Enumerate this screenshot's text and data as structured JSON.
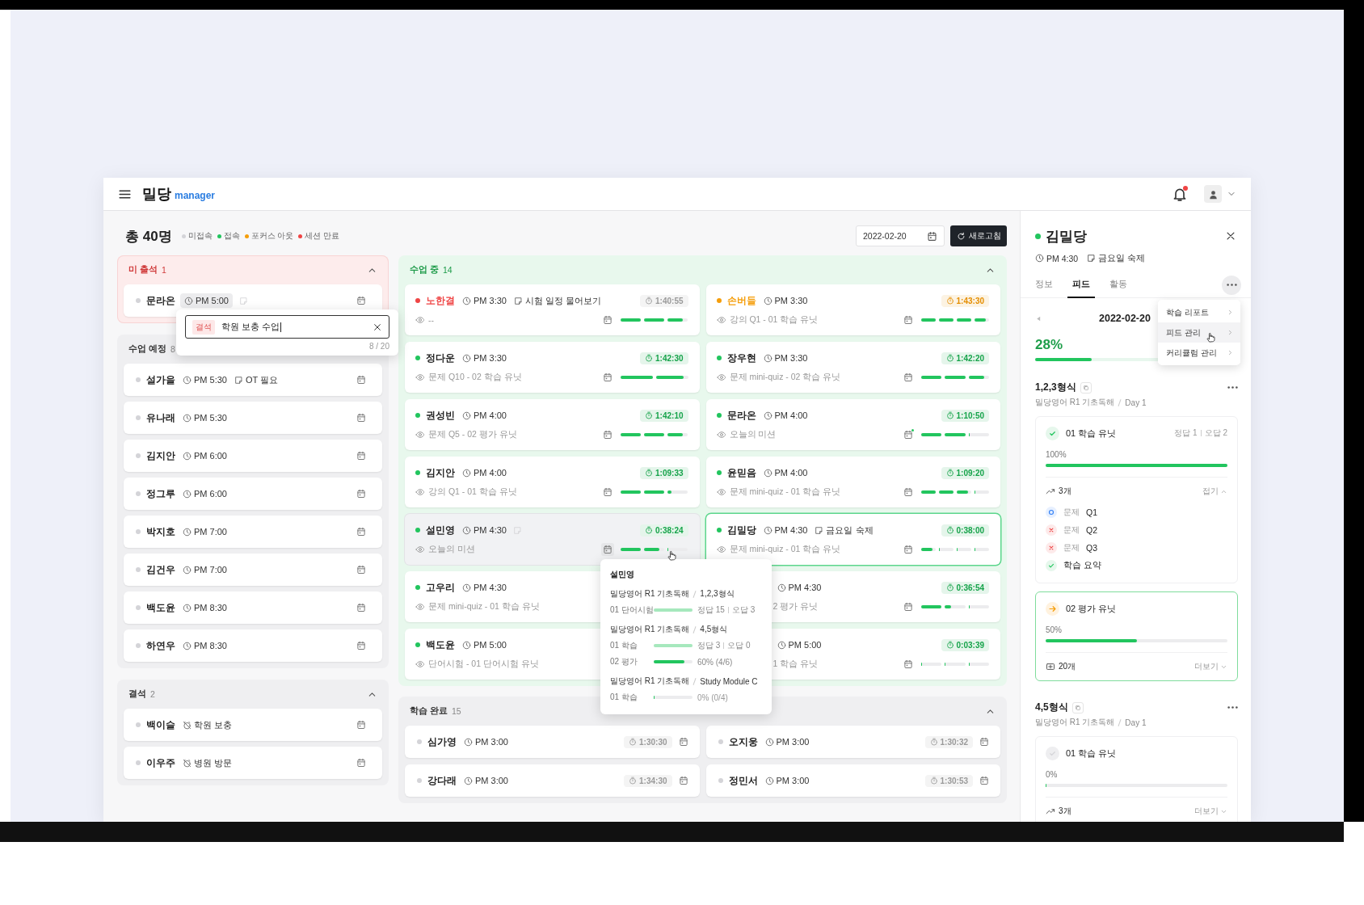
{
  "header": {
    "logo_main": "밀당",
    "logo_sub": "manager",
    "notification_dot": true
  },
  "summary": {
    "title": "총 40명",
    "legend": [
      {
        "label": "미접속",
        "color": "#d4d4d8"
      },
      {
        "label": "접속",
        "color": "#22c55e"
      },
      {
        "label": "포커스 아웃",
        "color": "#f59e0b"
      },
      {
        "label": "세션 만료",
        "color": "#ef4444"
      }
    ],
    "date": "2022-02-20",
    "refresh_label": "새로고침"
  },
  "left_panels": [
    {
      "kind": "absent",
      "title": "미 출석",
      "count": "1",
      "expanded": true,
      "students": [
        {
          "name": "문라온",
          "color": "#d4d4d8",
          "time": "PM 5:00",
          "has_memo": true,
          "editing": true
        }
      ]
    },
    {
      "kind": "scheduled",
      "title": "수업 예정",
      "count": "8",
      "students": [
        {
          "name": "설가을",
          "color": "#d4d4d8",
          "time": "PM 5:30",
          "note": "OT 필요"
        },
        {
          "name": "유나래",
          "color": "#d4d4d8",
          "time": "PM 5:30"
        },
        {
          "name": "김지안",
          "color": "#d4d4d8",
          "time": "PM 6:00"
        },
        {
          "name": "정그루",
          "color": "#d4d4d8",
          "time": "PM 6:00"
        },
        {
          "name": "박지호",
          "color": "#d4d4d8",
          "time": "PM 7:00"
        },
        {
          "name": "김건우",
          "color": "#d4d4d8",
          "time": "PM 7:00"
        },
        {
          "name": "백도윤",
          "color": "#d4d4d8",
          "time": "PM 8:30"
        },
        {
          "name": "하연우",
          "color": "#d4d4d8",
          "time": "PM 8:30"
        }
      ]
    },
    {
      "kind": "absence",
      "title": "결석",
      "count": "2",
      "expanded": true,
      "students": [
        {
          "name": "백이슬",
          "color": "#d4d4d8",
          "reason": "학원 보충"
        },
        {
          "name": "이우주",
          "color": "#d4d4d8",
          "reason": "병원 방문"
        }
      ]
    }
  ],
  "absence_popover": {
    "tag": "결석",
    "value": "학원 보충 수업",
    "counter": "8 / 20"
  },
  "board": [
    {
      "kind": "in_class",
      "title": "수업 중",
      "count": "14",
      "expanded": true,
      "cards": [
        {
          "name": "노한결",
          "color": "#ef4444",
          "name_highlight": true,
          "time": "PM 3:30",
          "note": "시험 일정 물어보기",
          "timer": {
            "text": "1:40:55",
            "color": "#9a9a9a"
          },
          "mission": "--",
          "segments": [
            {
              "level": 1
            },
            {
              "level": 1
            },
            {
              "level": 0.75
            }
          ],
          "calendar_dot": false,
          "hovered": false,
          "selected": false
        },
        {
          "name": "손버들",
          "color": "#f59e0b",
          "name_highlight": true,
          "time": "PM 3:30",
          "timer": {
            "text": "1:43:30",
            "color": "#e58e00"
          },
          "mission": "강의 Q1 - 01 학습 유닛",
          "segments": [
            {
              "level": 1
            },
            {
              "level": 1
            },
            {
              "level": 1
            },
            {
              "level": 0.75
            }
          ],
          "calendar_dot": false,
          "hovered": false,
          "selected": false
        },
        {
          "name": "정다운",
          "color": "#22c55e",
          "name_highlight": false,
          "time": "PM 3:30",
          "timer": {
            "text": "1:42:30",
            "color": "#16a34a"
          },
          "mission": "문제 Q10 - 02 학습 유닛",
          "segments": [
            {
              "level": 1
            },
            {
              "level": 0.87
            }
          ],
          "calendar_dot": false,
          "hovered": false,
          "selected": false
        },
        {
          "name": "장우현",
          "color": "#22c55e",
          "name_highlight": false,
          "time": "PM 3:30",
          "timer": {
            "text": "1:42:20",
            "color": "#16a34a"
          },
          "mission": "문제 mini-quiz - 02 학습 유닛",
          "segments": [
            {
              "level": 1
            },
            {
              "level": 1
            },
            {
              "level": 0.75
            }
          ],
          "calendar_dot": false,
          "hovered": false,
          "selected": false
        },
        {
          "name": "권성빈",
          "color": "#22c55e",
          "name_highlight": false,
          "time": "PM 4:00",
          "timer": {
            "text": "1:42:10",
            "color": "#16a34a"
          },
          "mission": "문제 Q5 - 02 평가 유닛",
          "segments": [
            {
              "level": 1
            },
            {
              "level": 1
            },
            {
              "level": 0.75
            }
          ],
          "calendar_dot": false,
          "hovered": false,
          "selected": false
        },
        {
          "name": "문라온",
          "color": "#22c55e",
          "name_highlight": false,
          "time": "PM 4:00",
          "timer": {
            "text": "1:10:50",
            "color": "#16a34a"
          },
          "mission": "오늘의 미션",
          "segments": [
            {
              "level": 1
            },
            {
              "level": 1
            },
            {
              "level": 0
            }
          ],
          "calendar_dot": true,
          "hovered": false,
          "selected": false
        },
        {
          "name": "김지안",
          "color": "#22c55e",
          "name_highlight": false,
          "time": "PM 4:00",
          "timer": {
            "text": "1:09:33",
            "color": "#16a34a"
          },
          "mission": "강의 Q1 - 01 학습 유닛",
          "segments": [
            {
              "level": 1
            },
            {
              "level": 1
            },
            {
              "level": 0.18
            }
          ],
          "calendar_dot": false,
          "hovered": false,
          "selected": false
        },
        {
          "name": "윤믿음",
          "color": "#22c55e",
          "name_highlight": false,
          "time": "PM 4:00",
          "timer": {
            "text": "1:09:20",
            "color": "#16a34a"
          },
          "mission": "문제 mini-quiz - 01 학습 유닛",
          "segments": [
            {
              "level": 1
            },
            {
              "level": 1
            },
            {
              "level": 0.75
            },
            {
              "level": 0
            }
          ],
          "calendar_dot": false,
          "hovered": false,
          "selected": false
        },
        {
          "name": "설민영",
          "color": "#22c55e",
          "name_highlight": false,
          "time": "PM 4:30",
          "has_memo": true,
          "timer": {
            "text": "0:38:24",
            "color": "#16a34a"
          },
          "mission": "오늘의 미션",
          "segments": [
            {
              "level": 1
            },
            {
              "level": 0.75
            },
            {
              "level": 0
            }
          ],
          "calendar_dot": false,
          "hovered": true,
          "selected": false
        },
        {
          "name": "김밀당",
          "color": "#22c55e",
          "name_highlight": false,
          "time": "PM 4:30",
          "note": "금요일 숙제",
          "timer": {
            "text": "0:38:00",
            "color": "#16a34a"
          },
          "mission": "문제 mini-quiz - 01 학습 유닛",
          "segments": [
            {
              "level": 0.75
            },
            {
              "level": 0
            },
            {
              "level": 0
            },
            {
              "level": 0
            }
          ],
          "calendar_dot": false,
          "hovered": false,
          "selected": true
        },
        {
          "name": "고우리",
          "color": "#22c55e",
          "name_highlight": false,
          "time": "PM 4:30",
          "mission": "문제 mini-quiz - 01 학습 유닛",
          "hovered": false,
          "selected": false
        },
        {
          "time": "PM 4:30",
          "timer": {
            "text": "0:36:54",
            "color": "#16a34a"
          },
          "mission": "2 평가 유닛",
          "segments": [
            {
              "level": 1
            },
            {
              "level": 0.3
            },
            {
              "level": 0
            }
          ],
          "calendar_dot": false,
          "hovered": false,
          "selected": false
        },
        {
          "name": "백도윤",
          "color": "#22c55e",
          "name_highlight": false,
          "time": "PM 5:00",
          "mission": "단어시험 - 01 단어시험 유닛",
          "hovered": false,
          "selected": false
        },
        {
          "time": "PM 5:00",
          "timer": {
            "text": "0:03:39",
            "color": "#16a34a"
          },
          "mission": "1 학습 유닛",
          "segments": [
            {
              "level": 0
            },
            {
              "level": 0
            },
            {
              "level": 0
            }
          ],
          "calendar_dot": false,
          "hovered": false,
          "selected": false
        }
      ]
    },
    {
      "kind": "completed",
      "title": "학습 완료",
      "count": "15",
      "expanded": true,
      "cards": [
        {
          "name": "심가영",
          "color": "#d4d4d8",
          "time": "PM 3:00",
          "timer": {
            "text": "1:30:30",
            "color": "#9a9a9a"
          }
        },
        {
          "name": "오지웅",
          "color": "#d4d4d8",
          "time": "PM 3:00",
          "timer": {
            "text": "1:30:32",
            "color": "#9a9a9a"
          }
        },
        {
          "name": "강다래",
          "color": "#d4d4d8",
          "time": "PM 3:00",
          "timer": {
            "text": "1:34:30",
            "color": "#9a9a9a"
          }
        },
        {
          "name": "정민서",
          "color": "#d4d4d8",
          "time": "PM 3:00",
          "timer": {
            "text": "1:30:53",
            "color": "#9a9a9a"
          }
        }
      ]
    }
  ],
  "tooltip": {
    "name": "설민영",
    "groups": [
      {
        "course": "밀당영어 R1 기초독해",
        "module": "1,2,3형식",
        "rows": [
          {
            "kind": "score",
            "label": "01 단어시험",
            "level": 1,
            "correct": "정답 15",
            "wrong": "오답 3"
          }
        ]
      },
      {
        "course": "밀당영어 R1 기초독해",
        "module": "4,5형식",
        "rows": [
          {
            "kind": "score",
            "label": "01 학습",
            "level": 1,
            "correct": "정답 3",
            "wrong": "오답 0"
          },
          {
            "kind": "percent",
            "label": "02 평가",
            "level": 0.8,
            "reading": "60% (4/6)"
          }
        ]
      },
      {
        "course": "밀당영어 R1 기초독해",
        "module": "Study Module C",
        "rows": [
          {
            "kind": "percent",
            "label": "01 학습",
            "level": 0,
            "reading": "0% (0/4)"
          }
        ]
      }
    ]
  },
  "student_panel": {
    "name": "김밀당",
    "color": "#22c55e",
    "time": "PM 4:30",
    "note": "금요일 숙제",
    "tabs": [
      {
        "label": "정보",
        "selected": false
      },
      {
        "label": "피드",
        "selected": true
      },
      {
        "label": "활동",
        "selected": false
      }
    ],
    "date": "2022-02-20",
    "progress_label": "28%",
    "level": 0.28,
    "menu": [
      {
        "label": "학습 리포트",
        "hovered": false
      },
      {
        "label": "피드 관리",
        "hovered": true
      },
      {
        "label": "커리큘럼 관리",
        "hovered": false
      }
    ],
    "sections": [
      {
        "title": "1,2,3형식",
        "course": "밀당영어 R1 기초독해",
        "day": "Day 1",
        "units": [
          {
            "kind": "done",
            "title": "01 학습 유닛",
            "correct": "정답 1",
            "wrong": "오답 2",
            "percent": "100%",
            "level": 1,
            "footer": {
              "kind": "trend",
              "count": "3개",
              "action": "접기"
            },
            "expanded": true,
            "items": [
              {
                "kind": "correct",
                "prefix": "문제",
                "label": "Q1"
              },
              {
                "kind": "wrong",
                "prefix": "문제",
                "label": "Q2"
              },
              {
                "kind": "wrong",
                "prefix": "문제",
                "label": "Q3"
              },
              {
                "kind": "done",
                "label": "학습 요약"
              }
            ]
          },
          {
            "kind": "current",
            "title": "02 평가 유닛",
            "percent": "50%",
            "level": 0.5,
            "footer": {
              "kind": "cards",
              "count": "20개",
              "action": "더보기"
            },
            "expanded": false
          }
        ]
      },
      {
        "title": "4,5형식",
        "course": "밀당영어 R1 기초독해",
        "day": "Day 1",
        "units": [
          {
            "kind": "todo",
            "title": "01 학습 유닛",
            "percent": "0%",
            "level": 0,
            "footer": {
              "kind": "trend",
              "count": "3개",
              "action": "더보기"
            },
            "expanded": false
          }
        ]
      }
    ]
  }
}
